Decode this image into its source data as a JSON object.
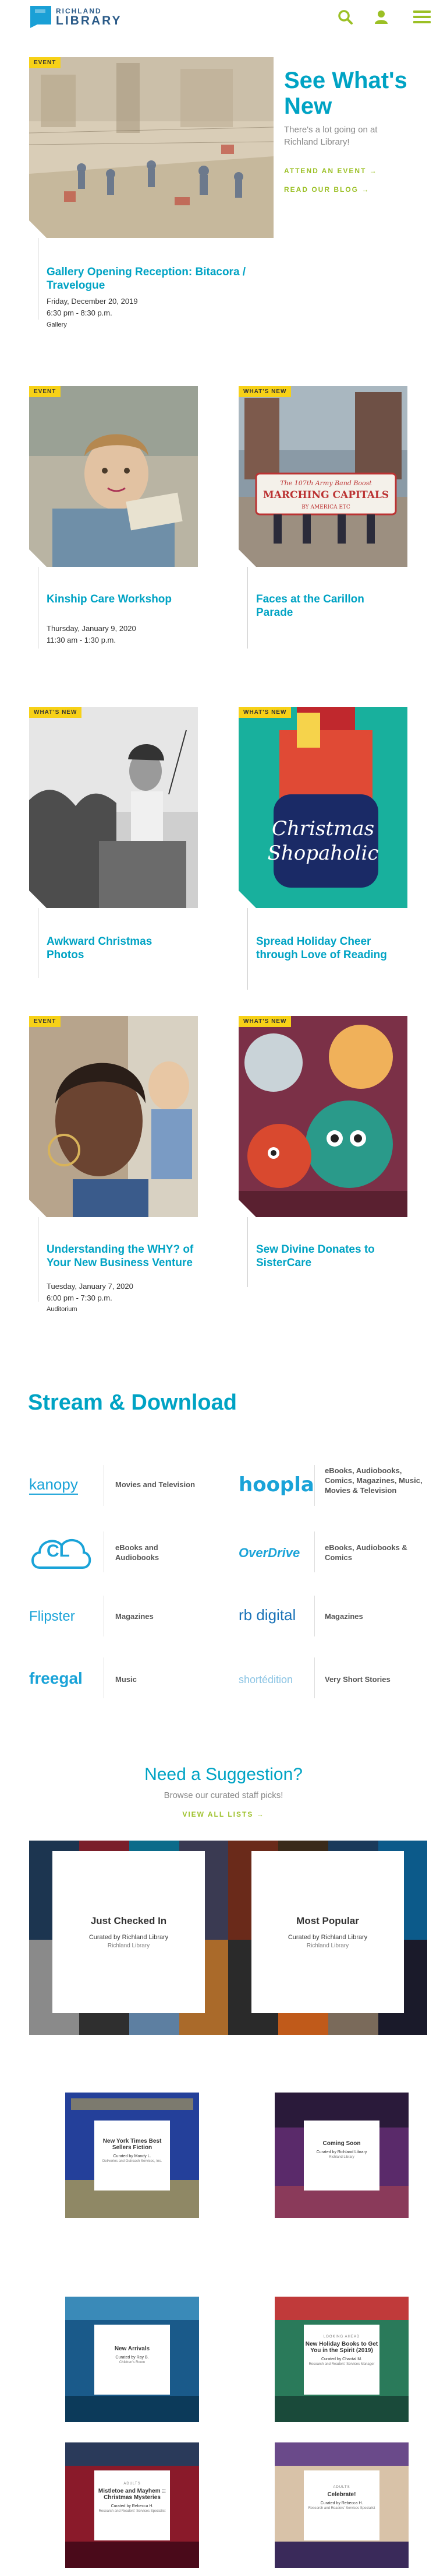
{
  "header": {
    "logo_line1": "RICHLAND",
    "logo_line2": "LIBRARY",
    "icons": [
      "search-icon",
      "user-icon",
      "menu-icon"
    ]
  },
  "colors": {
    "accent": "#00a3c4",
    "green": "#9bc025",
    "badge": "#f7d117",
    "logo_blue": "#2a5a88"
  },
  "featured": {
    "heading": "See What's New",
    "text": "There's a lot going on at Richland Library!",
    "attend_link": "ATTEND AN EVENT →",
    "blog_link": "READ OUR BLOG →"
  },
  "cards": [
    {
      "badge": "EVENT",
      "title": "Gallery Opening Reception: Bitacora / Travelogue",
      "date": "Friday, December 20, 2019",
      "time": "6:30 pm - 8:30 p.m.",
      "location": "Gallery"
    },
    {
      "badge": "EVENT",
      "title": "Kinship Care Workshop",
      "date": "Thursday, January 9, 2020",
      "time": "11:30 am - 1:30 p.m.",
      "location": ""
    },
    {
      "badge": "WHAT'S NEW",
      "title": "Faces at the Carillon Parade",
      "date": "",
      "time": "",
      "location": ""
    },
    {
      "badge": "WHAT'S NEW",
      "title": "Awkward Christmas Photos",
      "date": "",
      "time": "",
      "location": ""
    },
    {
      "badge": "WHAT'S NEW",
      "title": "Spread Holiday Cheer through Love of Reading",
      "date": "",
      "time": "",
      "location": ""
    },
    {
      "badge": "EVENT",
      "title": "Understanding the WHY? of Your New Business Venture",
      "date": "Tuesday, January 7, 2020",
      "time": "6:00 pm - 7:30 p.m.",
      "location": "Auditorium"
    },
    {
      "badge": "WHAT'S NEW",
      "title": "Sew Divine Donates to SisterCare",
      "date": "",
      "time": "",
      "location": ""
    }
  ],
  "photo_text": {
    "banner1": "The 107th Army Band Boost",
    "banner2": "MARCHING CAPITALS",
    "banner3": "BY AMERICA ETC",
    "christmas1": "Christmas",
    "christmas2": "Shopaholic"
  },
  "stream": {
    "heading": "Stream & Download",
    "providers": [
      {
        "logo": "kanopy",
        "desc": "Movies and Television"
      },
      {
        "logo": "hoopla",
        "desc": "eBooks, Audiobooks, Comics, Magazines, Music, Movies & Television"
      },
      {
        "logo": "CL",
        "desc": "eBooks and Audiobooks"
      },
      {
        "logo": "OverDrive",
        "desc": "eBooks, Audiobooks & Comics"
      },
      {
        "logo": "Flipster",
        "desc": "Magazines"
      },
      {
        "logo": "rb digital",
        "desc": "Magazines"
      },
      {
        "logo": "freegal",
        "desc": "Music"
      },
      {
        "logo": "shortédition",
        "desc": "Very Short Stories"
      }
    ]
  },
  "suggestion": {
    "heading": "Need a Suggestion?",
    "sub": "Browse our curated staff picks!",
    "link": "VIEW ALL LISTS →",
    "lists": [
      {
        "kicker": "",
        "title": "Just Checked In",
        "curator": "Curated by Richland Library",
        "org": "Richland Library"
      },
      {
        "kicker": "",
        "title": "Most Popular",
        "curator": "Curated by Richland Library",
        "org": "Richland Library"
      },
      {
        "kicker": "",
        "title": "New York Times Best Sellers Fiction",
        "curator": "Curated by Mandy L.",
        "org": "Deliveries and Outreach Services, Inc."
      },
      {
        "kicker": "",
        "title": "Coming Soon",
        "curator": "Curated by Richland Library",
        "org": "Richland Library"
      },
      {
        "kicker": "",
        "title": "New Arrivals",
        "curator": "Curated by Ray B.",
        "org": "Children's Room"
      },
      {
        "kicker": "LOOKING AHEAD",
        "title": "New Holiday Books to Get You in the Spirit (2019)",
        "curator": "Curated by Chantal M.",
        "org": "Research and Readers' Services Manager"
      },
      {
        "kicker": "ADULTS",
        "title": "Mistletoe and Mayhem :: Christmas Mysteries",
        "curator": "Curated by Rebecca H.",
        "org": "Research and Readers' Services Specialist"
      },
      {
        "kicker": "ADULTS",
        "title": "Celebrate!",
        "curator": "Curated by Rebecca H.",
        "org": "Research and Readers' Services Specialist"
      }
    ]
  }
}
